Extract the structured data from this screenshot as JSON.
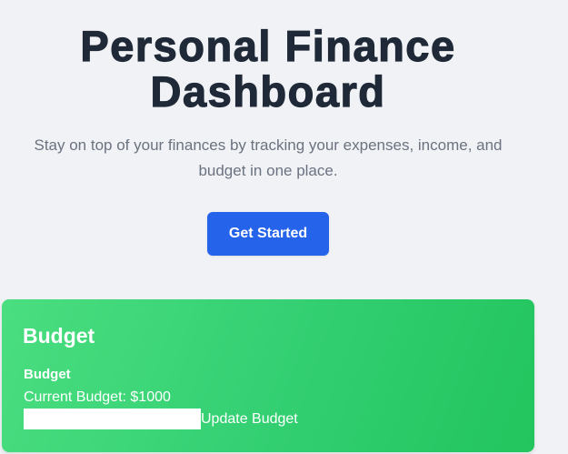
{
  "hero": {
    "title_line1": "Personal Finance",
    "title_line2": "Dashboard",
    "subtitle_line1": "Stay on top of your finances by tracking your expenses, income, and",
    "subtitle_line2": "budget in one place.",
    "cta_label": "Get Started"
  },
  "budget_card": {
    "title": "Budget",
    "section_label": "Budget",
    "current_budget_text": "Current Budget: $1000",
    "input_value": "",
    "input_placeholder": "",
    "update_label": "Update Budget"
  },
  "colors": {
    "page_background": "#f0f2f5",
    "title": "#1f2937",
    "subtitle": "#6b7280",
    "cta_background": "#2563eb",
    "card_gradient_start": "#4ade80",
    "card_gradient_end": "#22c55e"
  }
}
